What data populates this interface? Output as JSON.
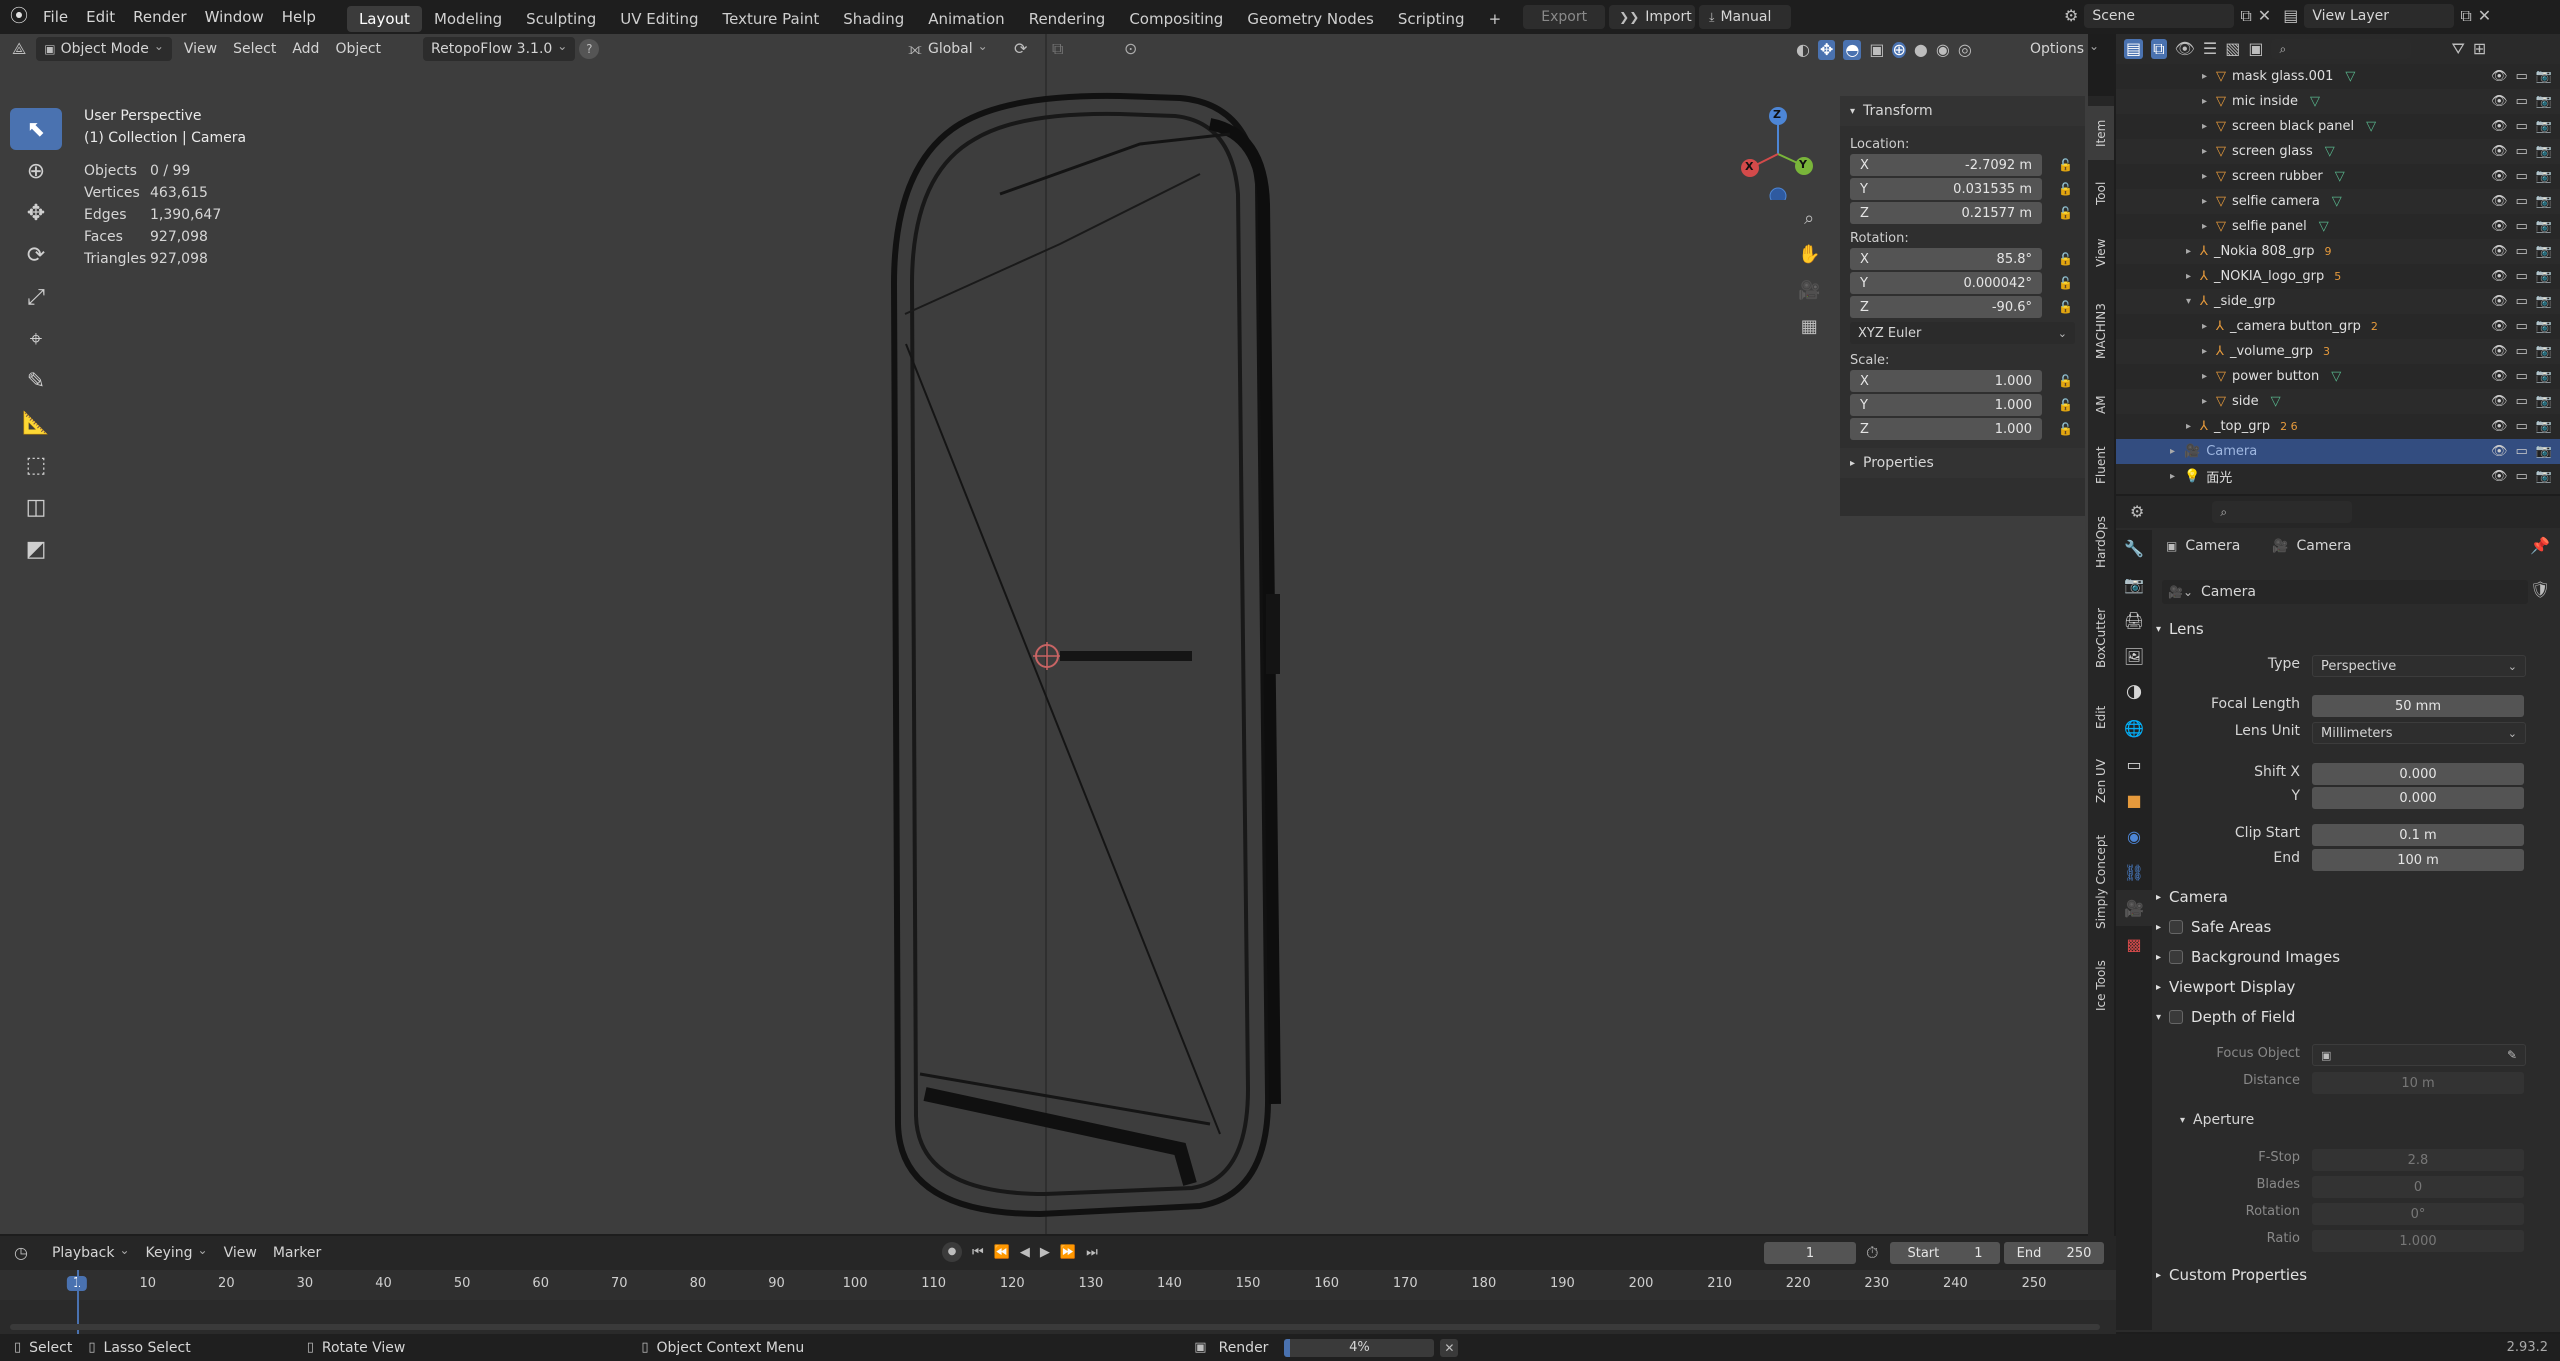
{
  "top_menu": [
    "File",
    "Edit",
    "Render",
    "Window",
    "Help"
  ],
  "workspaces": [
    "Layout",
    "Modeling",
    "Sculpting",
    "UV Editing",
    "Texture Paint",
    "Shading",
    "Animation",
    "Rendering",
    "Compositing",
    "Geometry Nodes",
    "Scripting"
  ],
  "active_workspace": "Layout",
  "add_workspace": "+",
  "export_label": "Export",
  "import_label": "Import",
  "manual_label": "Manual",
  "scene_name": "Scene",
  "view_layer_name": "View Layer",
  "viewport_header": {
    "mode": "Object Mode",
    "menus": [
      "View",
      "Select",
      "Add",
      "Object"
    ],
    "addon": "RetopoFlow 3.1.0",
    "help": "?",
    "orientation": "Global",
    "options": "Options"
  },
  "viewport_info": {
    "perspective": "User Perspective",
    "collection": "(1) Collection | Camera",
    "stats": [
      {
        "k": "Objects",
        "v": "0 / 99"
      },
      {
        "k": "Vertices",
        "v": "463,615"
      },
      {
        "k": "Edges",
        "v": "1,390,647"
      },
      {
        "k": "Faces",
        "v": "927,098"
      },
      {
        "k": "Triangles",
        "v": "927,098"
      }
    ]
  },
  "gizmo": {
    "x": "X",
    "y": "Y",
    "z": "Z"
  },
  "object_label": "Camera",
  "npanel": {
    "title": "Transform",
    "location_label": "Location:",
    "location": [
      {
        "a": "X",
        "v": "-2.7092 m"
      },
      {
        "a": "Y",
        "v": "0.031535 m"
      },
      {
        "a": "Z",
        "v": "0.21577 m"
      }
    ],
    "rotation_label": "Rotation:",
    "rotation": [
      {
        "a": "X",
        "v": "85.8°"
      },
      {
        "a": "Y",
        "v": "0.000042°"
      },
      {
        "a": "Z",
        "v": "-90.6°"
      }
    ],
    "euler": "XYZ Euler",
    "scale_label": "Scale:",
    "scale": [
      {
        "a": "X",
        "v": "1.000"
      },
      {
        "a": "Y",
        "v": "1.000"
      },
      {
        "a": "Z",
        "v": "1.000"
      }
    ],
    "properties": "Properties"
  },
  "side_tabs": [
    "Item",
    "Tool",
    "View",
    "MACHIN3",
    "AM",
    "Fluent",
    "HardOps",
    "BoxCutter",
    "Edit",
    "Zen UV",
    "Simply Concept",
    "Ice Tools"
  ],
  "outliner": [
    {
      "name": "mask glass.001",
      "indent": 5,
      "icon": "mesh",
      "tri": "▸"
    },
    {
      "name": "mic inside",
      "indent": 5,
      "icon": "mesh",
      "tri": "▸"
    },
    {
      "name": "screen black panel",
      "indent": 5,
      "icon": "mesh",
      "tri": "▸"
    },
    {
      "name": "screen glass",
      "indent": 5,
      "icon": "mesh",
      "tri": "▸"
    },
    {
      "name": "screen rubber",
      "indent": 5,
      "icon": "mesh",
      "tri": "▸"
    },
    {
      "name": "selfie camera",
      "indent": 5,
      "icon": "mesh",
      "tri": "▸"
    },
    {
      "name": "selfie panel",
      "indent": 5,
      "icon": "mesh",
      "tri": "▸"
    },
    {
      "name": "_Nokia 808_grp",
      "indent": 4,
      "icon": "empty",
      "tri": "▸",
      "badge": "9"
    },
    {
      "name": "_NOKIA_logo_grp",
      "indent": 4,
      "icon": "empty",
      "tri": "▸",
      "badge": "5"
    },
    {
      "name": "_side_grp",
      "indent": 4,
      "icon": "empty",
      "tri": "▾"
    },
    {
      "name": "_camera button_grp",
      "indent": 5,
      "icon": "empty",
      "tri": "▸",
      "badge": "2"
    },
    {
      "name": "_volume_grp",
      "indent": 5,
      "icon": "empty",
      "tri": "▸",
      "badge": "3"
    },
    {
      "name": "power button",
      "indent": 5,
      "icon": "mesh",
      "tri": "▸"
    },
    {
      "name": "side",
      "indent": 5,
      "icon": "mesh",
      "tri": "▸"
    },
    {
      "name": "_top_grp",
      "indent": 4,
      "icon": "empty",
      "tri": "▸",
      "badge": "2 6"
    },
    {
      "name": "Camera",
      "indent": 3,
      "icon": "camera",
      "tri": "▸",
      "selected": true
    },
    {
      "name": "面光",
      "indent": 3,
      "icon": "light",
      "tri": "▸"
    }
  ],
  "properties": {
    "breadcrumb_object": "Camera",
    "breadcrumb_data": "Camera",
    "datablock": "Camera",
    "lens_section": "Lens",
    "type_label": "Type",
    "type_value": "Perspective",
    "focal_label": "Focal Length",
    "focal_value": "50 mm",
    "lens_unit_label": "Lens Unit",
    "lens_unit_value": "Millimeters",
    "shift_x_label": "Shift X",
    "shift_x_value": "0.000",
    "shift_y_label": "Y",
    "shift_y_value": "0.000",
    "clip_start_label": "Clip Start",
    "clip_start_value": "0.1 m",
    "clip_end_label": "End",
    "clip_end_value": "100 m",
    "camera_section": "Camera",
    "safe_areas": "Safe Areas",
    "background_images": "Background Images",
    "viewport_display": "Viewport Display",
    "dof": "Depth of Field",
    "focus_object_label": "Focus Object",
    "distance_label": "Distance",
    "distance_value": "10 m",
    "aperture": "Aperture",
    "fstop_label": "F-Stop",
    "fstop_value": "2.8",
    "blades_label": "Blades",
    "blades_value": "0",
    "rotation_label": "Rotation",
    "rotation_value": "0°",
    "ratio_label": "Ratio",
    "ratio_value": "1.000",
    "custom_properties": "Custom Properties"
  },
  "timeline": {
    "menus": [
      "Playback",
      "Keying",
      "View",
      "Marker"
    ],
    "current_frame": "1",
    "start_label": "Start",
    "start_value": "1",
    "end_label": "End",
    "end_value": "250",
    "ruler": [
      "1",
      "10",
      "20",
      "30",
      "40",
      "50",
      "60",
      "70",
      "80",
      "90",
      "100",
      "110",
      "120",
      "130",
      "140",
      "150",
      "160",
      "170",
      "180",
      "190",
      "200",
      "210",
      "220",
      "230",
      "240",
      "250"
    ]
  },
  "statusbar": {
    "select": "Select",
    "lasso": "Lasso Select",
    "rotate": "Rotate View",
    "context": "Object Context Menu",
    "render_label": "Render",
    "render_progress": 0.04,
    "render_percent": "4%",
    "version": "2.93.2"
  }
}
